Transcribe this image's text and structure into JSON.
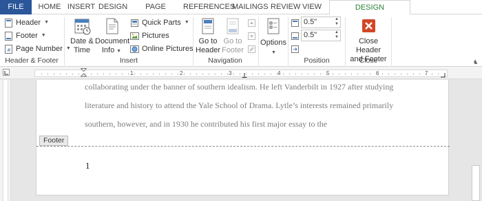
{
  "tabs": [
    "FILE",
    "HOME",
    "INSERT",
    "DESIGN",
    "PAGE LAYOUT",
    "REFERENCES",
    "MAILINGS",
    "REVIEW",
    "VIEW"
  ],
  "context_tab": "DESIGN",
  "groups": {
    "header_footer": {
      "label": "Header & Footer",
      "header": "Header",
      "footer": "Footer",
      "page_number": "Page Number"
    },
    "insert": {
      "label": "Insert",
      "date_time": [
        "Date &",
        "Time"
      ],
      "document_info": [
        "Document",
        "Info"
      ],
      "quick_parts": "Quick Parts",
      "pictures": "Pictures",
      "online_pictures": "Online Pictures"
    },
    "navigation": {
      "label": "Navigation",
      "go_to_header": [
        "Go to",
        "Header"
      ],
      "go_to_footer": [
        "Go to",
        "Footer"
      ]
    },
    "options": {
      "label": "Options"
    },
    "position": {
      "label": "Position",
      "header_from_top": "0.5\"",
      "footer_from_bottom": "0.5\""
    },
    "close": {
      "label": "Close",
      "close_button": [
        "Close Header",
        "and Footer"
      ]
    }
  },
  "ruler_numbers": [
    "1",
    "2",
    "3",
    "4",
    "5",
    "6",
    "7"
  ],
  "document": {
    "lines": [
      "collaborating under the banner of southern idealism.  He left Vanderbilt in 1927 after studying",
      "literature and history to attend the Yale School of Drama.  Lytle’s interests remained primarily",
      "southern, however, and in 1930 he contributed his first major essay to the"
    ],
    "footer_label": "Footer",
    "page_number": "1"
  },
  "colors": {
    "file_tab": "#2b579a",
    "context_tab": "#2b8034",
    "close_icon": "#d24726"
  }
}
